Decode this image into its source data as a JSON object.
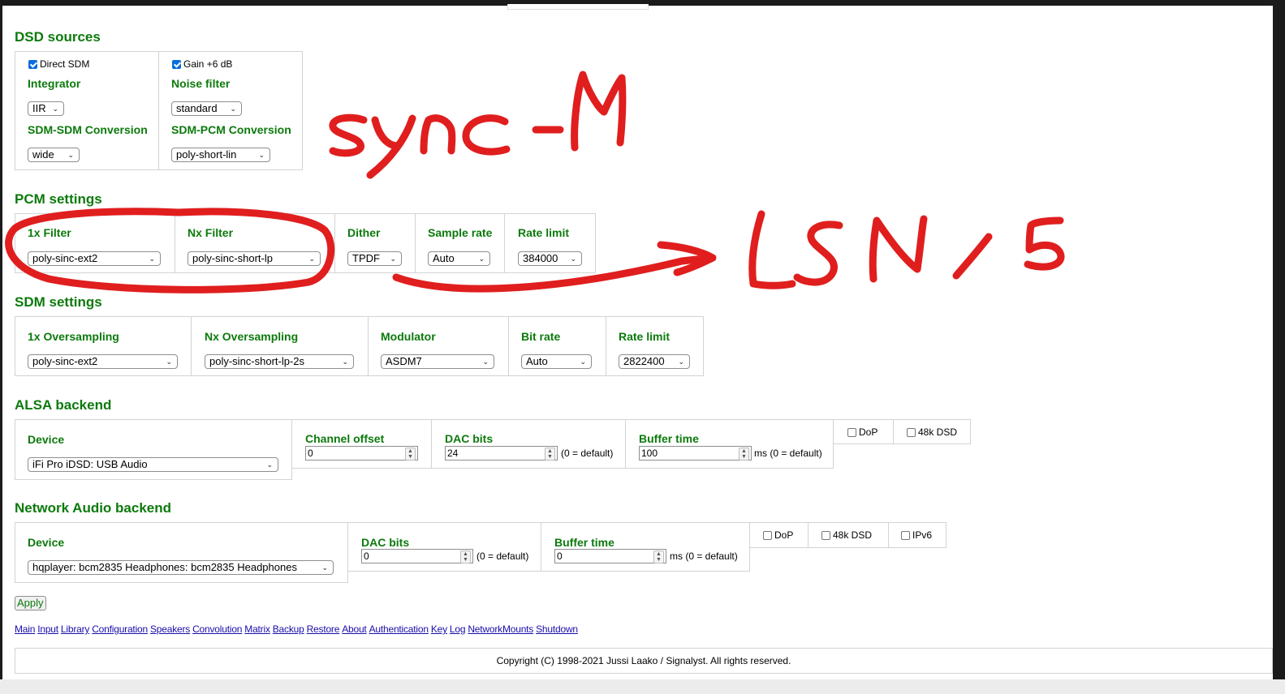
{
  "dsd": {
    "title": "DSD sources",
    "direct_sdm": "Direct SDM",
    "gain": "Gain +6 dB",
    "integrator_label": "Integrator",
    "integrator_value": "IIR",
    "noise_filter_label": "Noise filter",
    "noise_filter_value": "standard",
    "sdm_sdm_label": "SDM-SDM Conversion",
    "sdm_sdm_value": "wide",
    "sdm_pcm_label": "SDM-PCM Conversion",
    "sdm_pcm_value": "poly-short-lin"
  },
  "pcm": {
    "title": "PCM settings",
    "filter1x_label": "1x Filter",
    "filter1x_value": "poly-sinc-ext2",
    "filternx_label": "Nx Filter",
    "filternx_value": "poly-sinc-short-lp",
    "dither_label": "Dither",
    "dither_value": "TPDF",
    "samplerate_label": "Sample rate",
    "samplerate_value": "Auto",
    "ratelimit_label": "Rate limit",
    "ratelimit_value": "384000"
  },
  "sdm": {
    "title": "SDM settings",
    "os1x_label": "1x Oversampling",
    "os1x_value": "poly-sinc-ext2",
    "osnx_label": "Nx Oversampling",
    "osnx_value": "poly-sinc-short-lp-2s",
    "modulator_label": "Modulator",
    "modulator_value": "ASDM7",
    "bitrate_label": "Bit rate",
    "bitrate_value": "Auto",
    "ratelimit_label": "Rate limit",
    "ratelimit_value": "2822400"
  },
  "alsa": {
    "title": "ALSA backend",
    "device_label": "Device",
    "device_value": "iFi Pro iDSD: USB Audio",
    "channel_offset_label": "Channel offset",
    "channel_offset_value": "0",
    "dac_bits_label": "DAC bits",
    "dac_bits_value": "24",
    "dac_bits_hint": "(0 = default)",
    "buffer_label": "Buffer time",
    "buffer_value": "100",
    "buffer_hint": "ms (0 = default)",
    "dop": "DoP",
    "dsd48k": "48k DSD"
  },
  "nab": {
    "title": "Network Audio backend",
    "device_label": "Device",
    "device_value": "hqplayer: bcm2835 Headphones: bcm2835 Headphones",
    "dac_bits_label": "DAC bits",
    "dac_bits_value": "0",
    "dac_bits_hint": "(0 = default)",
    "buffer_label": "Buffer time",
    "buffer_value": "0",
    "buffer_hint": "ms (0 = default)",
    "dop": "DoP",
    "dsd48k": "48k DSD",
    "ipv6": "IPv6"
  },
  "apply_label": "Apply",
  "nav": {
    "links": [
      "Main",
      "Input",
      "Library",
      "Configuration",
      "Speakers",
      "Convolution",
      "Matrix",
      "Backup",
      "Restore",
      "About",
      "Authentication",
      "Key",
      "Log",
      "NetworkMounts",
      "Shutdown"
    ]
  },
  "footer": {
    "copyright": "Copyright (C) 1998-2021 Jussi Laako / Signalyst. All rights reserved."
  },
  "colors": {
    "label_green": "#0c7a0c",
    "annotation_red": "#e01e1e",
    "link_blue": "#1a0dab",
    "checkbox_blue": "#0a6ddc"
  }
}
